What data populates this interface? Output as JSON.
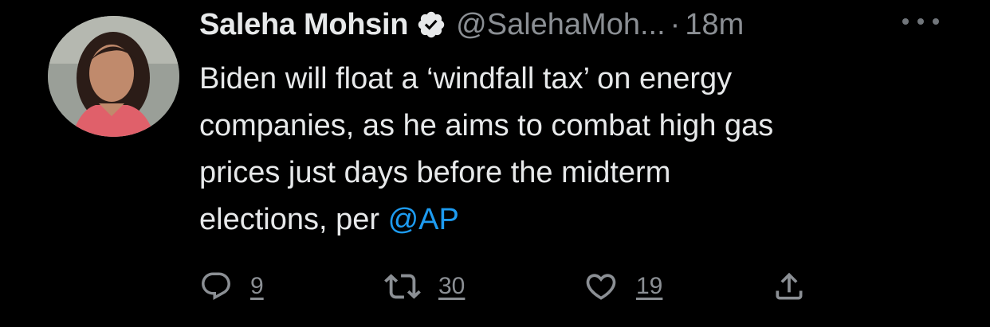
{
  "tweet": {
    "author": {
      "display_name": "Saleha Mohsin",
      "handle": "@SalehaMoh...",
      "verified": true,
      "avatar_icon": "profile-photo"
    },
    "timestamp_separator": "·",
    "timestamp": "18m",
    "text_lines": [
      "Biden will float a ‘windfall tax’ on energy",
      "companies, as he aims to combat high gas",
      "prices just days before the midterm",
      "elections, per "
    ],
    "mention": "@AP",
    "actions": {
      "replies": "9",
      "retweets": "30",
      "likes": "19"
    },
    "icons": {
      "verified": "verified-badge-icon",
      "more": "more-options-icon",
      "reply": "reply-icon",
      "retweet": "retweet-icon",
      "like": "heart-icon",
      "share": "share-icon"
    },
    "colors": {
      "background": "#000000",
      "text": "#e7e9ea",
      "secondary": "#8b8f94",
      "accent": "#1d9bf0"
    }
  }
}
